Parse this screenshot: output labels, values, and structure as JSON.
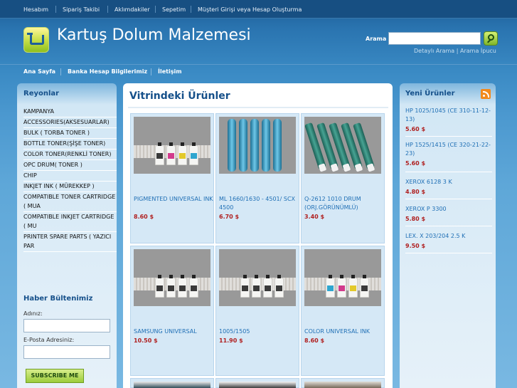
{
  "topnav": {
    "items": [
      "Hesabım",
      "Sipariş Takibi",
      "Aklımdakiler",
      "Sepetim",
      "Müşteri Girişi veya Hesap Oluşturma"
    ]
  },
  "header": {
    "title": "Kartuş Dolum Malzemesi",
    "search_label": "Arama",
    "search_placeholder": "",
    "advanced_search": "Detaylı Arama",
    "search_sep": "|",
    "search_tips": "Arama İpucu"
  },
  "mainnav": {
    "items": [
      "Ana Sayfa",
      "Banka Hesap Bilgilerimiz",
      "İletişim"
    ]
  },
  "sidebar": {
    "title": "Reyonlar",
    "categories": [
      "KAMPANYA",
      "ACCESSORIES(AKSESUARLAR)",
      "BULK ( TORBA TONER )",
      "BOTTLE TONER(ŞİŞE TONER)",
      "COLOR TONER(RENKLİ TONER)",
      "OPC DRUM( TONER )",
      "CHIP",
      "INKJET INK ( MÜREKKEP )",
      "COMPATIBLE TONER CARTRIDGE ( MUA",
      "COMPATIBLE INKJET CARTRIDGE ( MU",
      "PRINTER SPARE PARTS ( YAZICI PAR"
    ]
  },
  "newsletter": {
    "title": "Haber Bültenimiz",
    "name_label": "Adınız:",
    "email_label": "E-Posta Adresiniz:",
    "subscribe": "SUBSCRIBE ME"
  },
  "featured": {
    "title": "Vitrindeki Ürünler",
    "products": [
      {
        "name": "PIGMENTED UNIVERSAL INK",
        "price": "8.60 $",
        "photo": "bottles"
      },
      {
        "name": "ML 1660/1630 - 4501/ SCX 4500",
        "price": "6.70 $",
        "photo": "drum-cylinders"
      },
      {
        "name": "Q-2612 1010 DRUM (ORJ.GÖRÜNÜMLÜ)",
        "price": "3.40 $",
        "photo": "opc-drums"
      },
      {
        "name": "SAMSUNG UNIVERSAL",
        "price": "10.50 $",
        "photo": "bottles"
      },
      {
        "name": "1005/1505",
        "price": "11.90 $",
        "photo": "bottles"
      },
      {
        "name": "COLOR UNIVERSAL INK",
        "price": "8.60 $",
        "photo": "bottles"
      }
    ]
  },
  "new_products": {
    "title": "Yeni Ürünler",
    "items": [
      {
        "name": "HP 1025/1045 (CE 310-11-12-13)",
        "price": "5.60 $"
      },
      {
        "name": "HP 1525/1415 (CE 320-21-22-23)",
        "price": "5.60 $"
      },
      {
        "name": "XEROX 6128 3 K",
        "price": "4.80 $"
      },
      {
        "name": "XEROX P 3300",
        "price": "5.80 $"
      },
      {
        "name": "LEX. X 203/204 2.5 K",
        "price": "9.50 $"
      }
    ]
  },
  "colors": {
    "accent": "#15508a",
    "link": "#1f6fb5",
    "price": "#b02020"
  }
}
